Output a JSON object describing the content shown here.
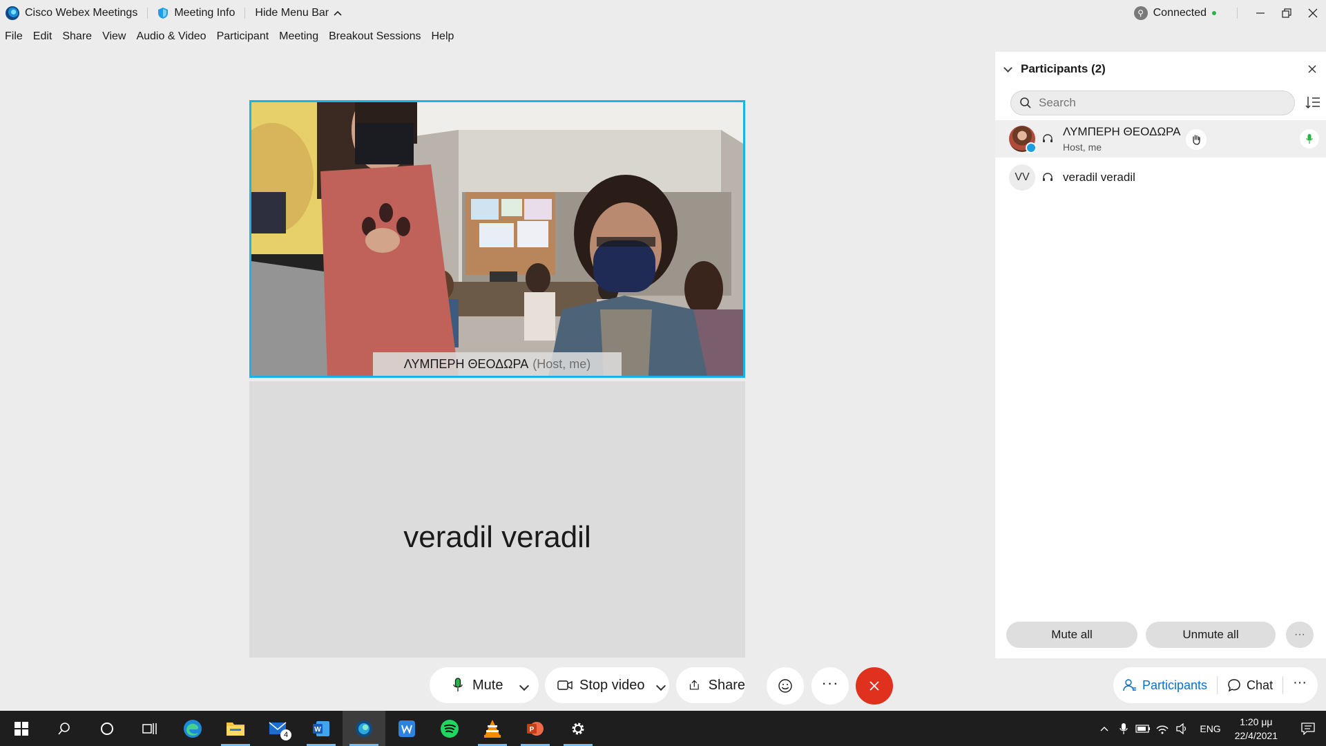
{
  "titlebar": {
    "app_name": "Cisco Webex Meetings",
    "meeting_info": "Meeting Info",
    "hide_menu": "Hide Menu Bar",
    "status": "Connected"
  },
  "menu": [
    "File",
    "Edit",
    "Share",
    "View",
    "Audio & Video",
    "Participant",
    "Meeting",
    "Breakout Sessions",
    "Help"
  ],
  "video": {
    "main_name": "ΛΥΜΠΕΡΗ ΘΕΟΔΩΡΑ",
    "main_role": "(Host, me)",
    "second_name": "veradil veradil"
  },
  "controls": {
    "mute": "Mute",
    "stop_video": "Stop video",
    "share": "Share"
  },
  "participants": {
    "title": "Participants (2)",
    "search_placeholder": "Search",
    "list": [
      {
        "name": "ΛΥΜΠΕΡΗ ΘΕΟΔΩΡΑ",
        "sub": "Host, me",
        "initials": ""
      },
      {
        "name": "veradil veradil",
        "sub": "",
        "initials": "VV"
      }
    ],
    "mute_all": "Mute all",
    "unmute_all": "Unmute all"
  },
  "panel_tabs": {
    "participants": "Participants",
    "chat": "Chat"
  },
  "taskbar": {
    "mail_badge": "4",
    "language": "ENG",
    "time": "1:20 μμ",
    "date": "22/4/2021"
  },
  "colors": {
    "active_border": "#19b4e6",
    "end_call": "#e0301e",
    "accent_blue": "#0b6fd0",
    "connected_green": "#2bb34a"
  }
}
